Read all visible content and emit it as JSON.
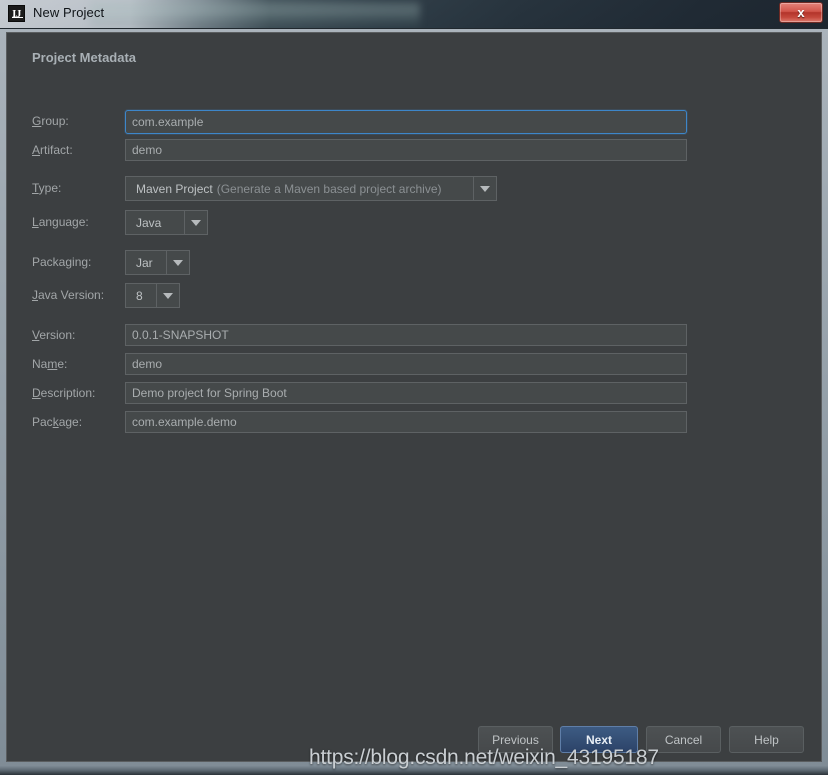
{
  "window": {
    "title": "New Project",
    "icon": "intellij-idea-icon",
    "close_label": "x",
    "colors": {
      "panel_bg": "#3c3f41",
      "field_bg": "#45494a",
      "focus_border": "#3d86c9",
      "primary_button": "#35517a",
      "close_button": "#c4483c",
      "label_text": "#a2a6a8"
    }
  },
  "form": {
    "section_title": "Project Metadata",
    "fields": [
      {
        "type": "text",
        "label_prefix": "",
        "label_mnemonic": "G",
        "label_suffix": "roup:",
        "label_full": "Group:",
        "value": "com.example",
        "focused": true
      },
      {
        "type": "text",
        "label_prefix": "",
        "label_mnemonic": "A",
        "label_suffix": "rtifact:",
        "label_full": "Artifact:",
        "value": "demo",
        "focused": false
      },
      {
        "type": "combo",
        "label_prefix": "",
        "label_mnemonic": "T",
        "label_suffix": "ype:",
        "label_full": "Type:",
        "value": "Maven Project",
        "value_hint": "(Generate a Maven based project archive)"
      },
      {
        "type": "combo",
        "label_prefix": "",
        "label_mnemonic": "L",
        "label_suffix": "anguage:",
        "label_full": "Language:",
        "value": "Java",
        "value_hint": ""
      },
      {
        "type": "combo",
        "label_prefix": "Packaging:",
        "label_mnemonic": "",
        "label_suffix": "",
        "label_full": "Packaging:",
        "value": "Jar",
        "value_hint": ""
      },
      {
        "type": "combo",
        "label_prefix": "",
        "label_mnemonic": "J",
        "label_suffix": "ava Version:",
        "label_full": "Java Version:",
        "value": "8",
        "value_hint": ""
      },
      {
        "type": "text",
        "label_prefix": "",
        "label_mnemonic": "V",
        "label_suffix": "ersion:",
        "label_full": "Version:",
        "value": "0.0.1-SNAPSHOT",
        "focused": false
      },
      {
        "type": "text",
        "label_prefix": "Na",
        "label_mnemonic": "m",
        "label_suffix": "e:",
        "label_full": "Name:",
        "value": "demo",
        "focused": false
      },
      {
        "type": "text",
        "label_prefix": "",
        "label_mnemonic": "D",
        "label_suffix": "escription:",
        "label_full": "Description:",
        "value": "Demo project for Spring Boot",
        "focused": false
      },
      {
        "type": "text",
        "label_prefix": "Pac",
        "label_mnemonic": "k",
        "label_suffix": "age:",
        "label_full": "Package:",
        "value": "com.example.demo",
        "focused": false
      }
    ]
  },
  "buttons": {
    "previous": "Previous",
    "next": "Next",
    "cancel": "Cancel",
    "help": "Help"
  },
  "watermark": "https://blog.csdn.net/weixin_43195187"
}
